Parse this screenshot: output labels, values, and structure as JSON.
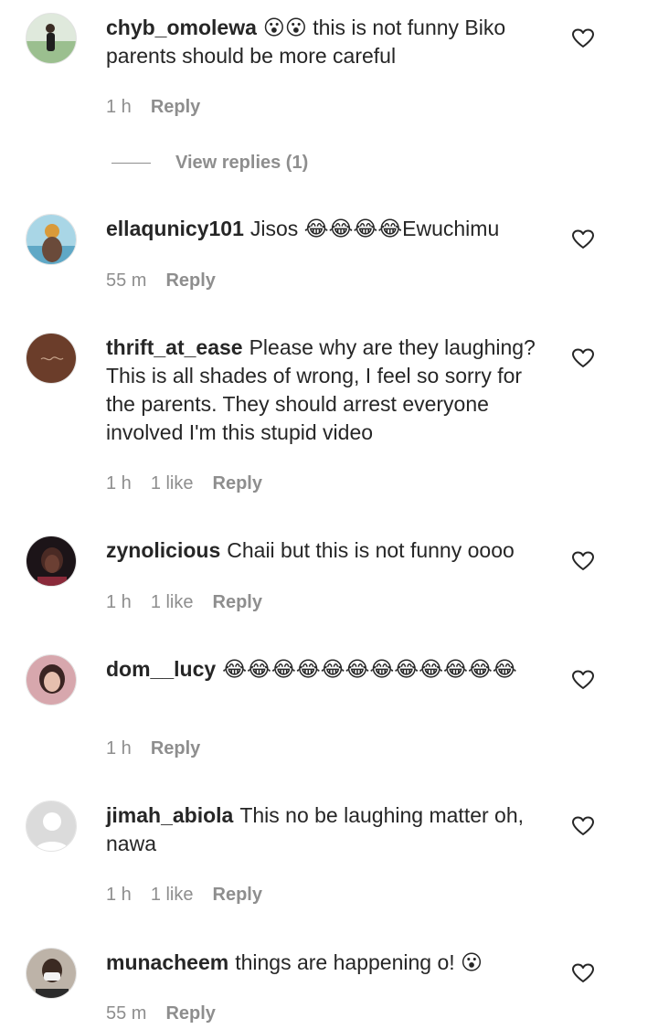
{
  "comments": [
    {
      "username": "chyb_omolewa",
      "text": "😮😮 this is not funny Biko parents should be more careful",
      "time": "1 h",
      "likes": "",
      "reply": "Reply",
      "avatar_color": "#7fa37c"
    },
    {
      "username": "ellaqunicy101",
      "text": "Jisos 😂😂😂😂Ewuchimu",
      "time": "55 m",
      "likes": "",
      "reply": "Reply",
      "avatar_color": "#8fc4d8"
    },
    {
      "username": "thrift_at_ease",
      "text": "Please why are they laughing? This is all shades of wrong, I feel so sorry for the parents. They should arrest everyone involved I'm this stupid video",
      "time": "1 h",
      "likes": "1 like",
      "reply": "Reply",
      "avatar_color": "#6b3d2a"
    },
    {
      "username": "zynolicious",
      "text": "Chaii but this is not funny oooo",
      "time": "1 h",
      "likes": "1 like",
      "reply": "Reply",
      "avatar_color": "#2a1a22"
    },
    {
      "username": "dom__lucy",
      "text": "😂😂😂😂😂😂😂😂😂😂😂😂",
      "time": "1 h",
      "likes": "",
      "reply": "Reply",
      "avatar_color": "#b8717a"
    },
    {
      "username": "jimah_abiola",
      "text": "This no be laughing matter oh, nawa",
      "time": "1 h",
      "likes": "1 like",
      "reply": "Reply",
      "avatar_color": "#dbdbdb"
    },
    {
      "username": "munacheem",
      "text": "things are happening o! 😮",
      "time": "55 m",
      "likes": "",
      "reply": "Reply",
      "avatar_color": "#6e6258"
    }
  ],
  "view_replies": "View replies (1)",
  "icons": {
    "like": "heart-outline-icon",
    "default_avatar": "default-avatar-icon"
  }
}
